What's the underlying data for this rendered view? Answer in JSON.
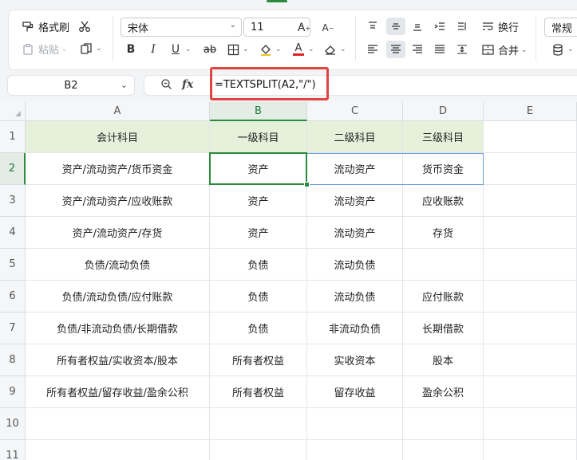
{
  "ribbon": {
    "format_painter_label": "格式刷",
    "paste_label": "粘贴",
    "font_name": "宋体",
    "font_size": "11",
    "wrap_label": "换行",
    "merge_label": "合并",
    "number_format": "常规"
  },
  "formula_bar": {
    "cell_ref": "B2",
    "fx_label": "fx",
    "formula": "=TEXTSPLIT(A2,\"/\")"
  },
  "sheet": {
    "columns": [
      "A",
      "B",
      "C",
      "D",
      "E"
    ],
    "rows": [
      "1",
      "2",
      "3",
      "4",
      "5",
      "6",
      "7",
      "8",
      "9",
      "10",
      "11"
    ],
    "selected_cell": "B2",
    "header_row": [
      "会计科目",
      "一级科目",
      "二级科目",
      "三级科目"
    ],
    "data": [
      [
        "资产/流动资产/货币资金",
        "资产",
        "流动资产",
        "货币资金"
      ],
      [
        "资产/流动资产/应收账款",
        "资产",
        "流动资产",
        "应收账款"
      ],
      [
        "资产/流动资产/存货",
        "资产",
        "流动资产",
        "存货"
      ],
      [
        "负债/流动负债",
        "负债",
        "流动负债",
        ""
      ],
      [
        "负债/流动负债/应付账款",
        "负债",
        "流动负债",
        "应付账款"
      ],
      [
        "负债/非流动负债/长期借款",
        "负债",
        "非流动负债",
        "长期借款"
      ],
      [
        "所有者权益/实收资本/股本",
        "所有者权益",
        "实收资本",
        "股本"
      ],
      [
        "所有者权益/留存收益/盈余公积",
        "所有者权益",
        "留存收益",
        "盈余公积"
      ]
    ]
  }
}
